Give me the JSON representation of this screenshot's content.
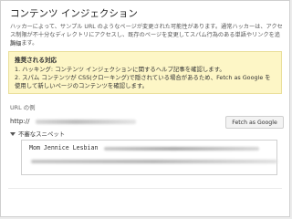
{
  "page": {
    "title": "コンテンツ インジェクション",
    "description": "ハッカーによって、サンプル URL のようなページが変更された可能性があります。通常ハッカーは、アクセス制限が不十分なディレクトリにアクセスし、既存のページを変更してスパム行為のある単語やリンクを追加します。",
    "details_link": "詳細"
  },
  "notice": {
    "title": "推奨される対応",
    "items": [
      "1. ハッキング: コンテンツ インジェクションに関するヘルプ記事を確認します。",
      "2. スパム コンテンツが CSS(クローキング)で隠されている場合があるため、Fetch as Google を使用して新しいページのコンテンツを確認します。"
    ]
  },
  "url": {
    "label": "URL の例",
    "value": "http://",
    "fetch_button": "Fetch as Google"
  },
  "snippet": {
    "toggle_label": "不審なスニペット",
    "text": "Mom Jennice Lesbian"
  }
}
